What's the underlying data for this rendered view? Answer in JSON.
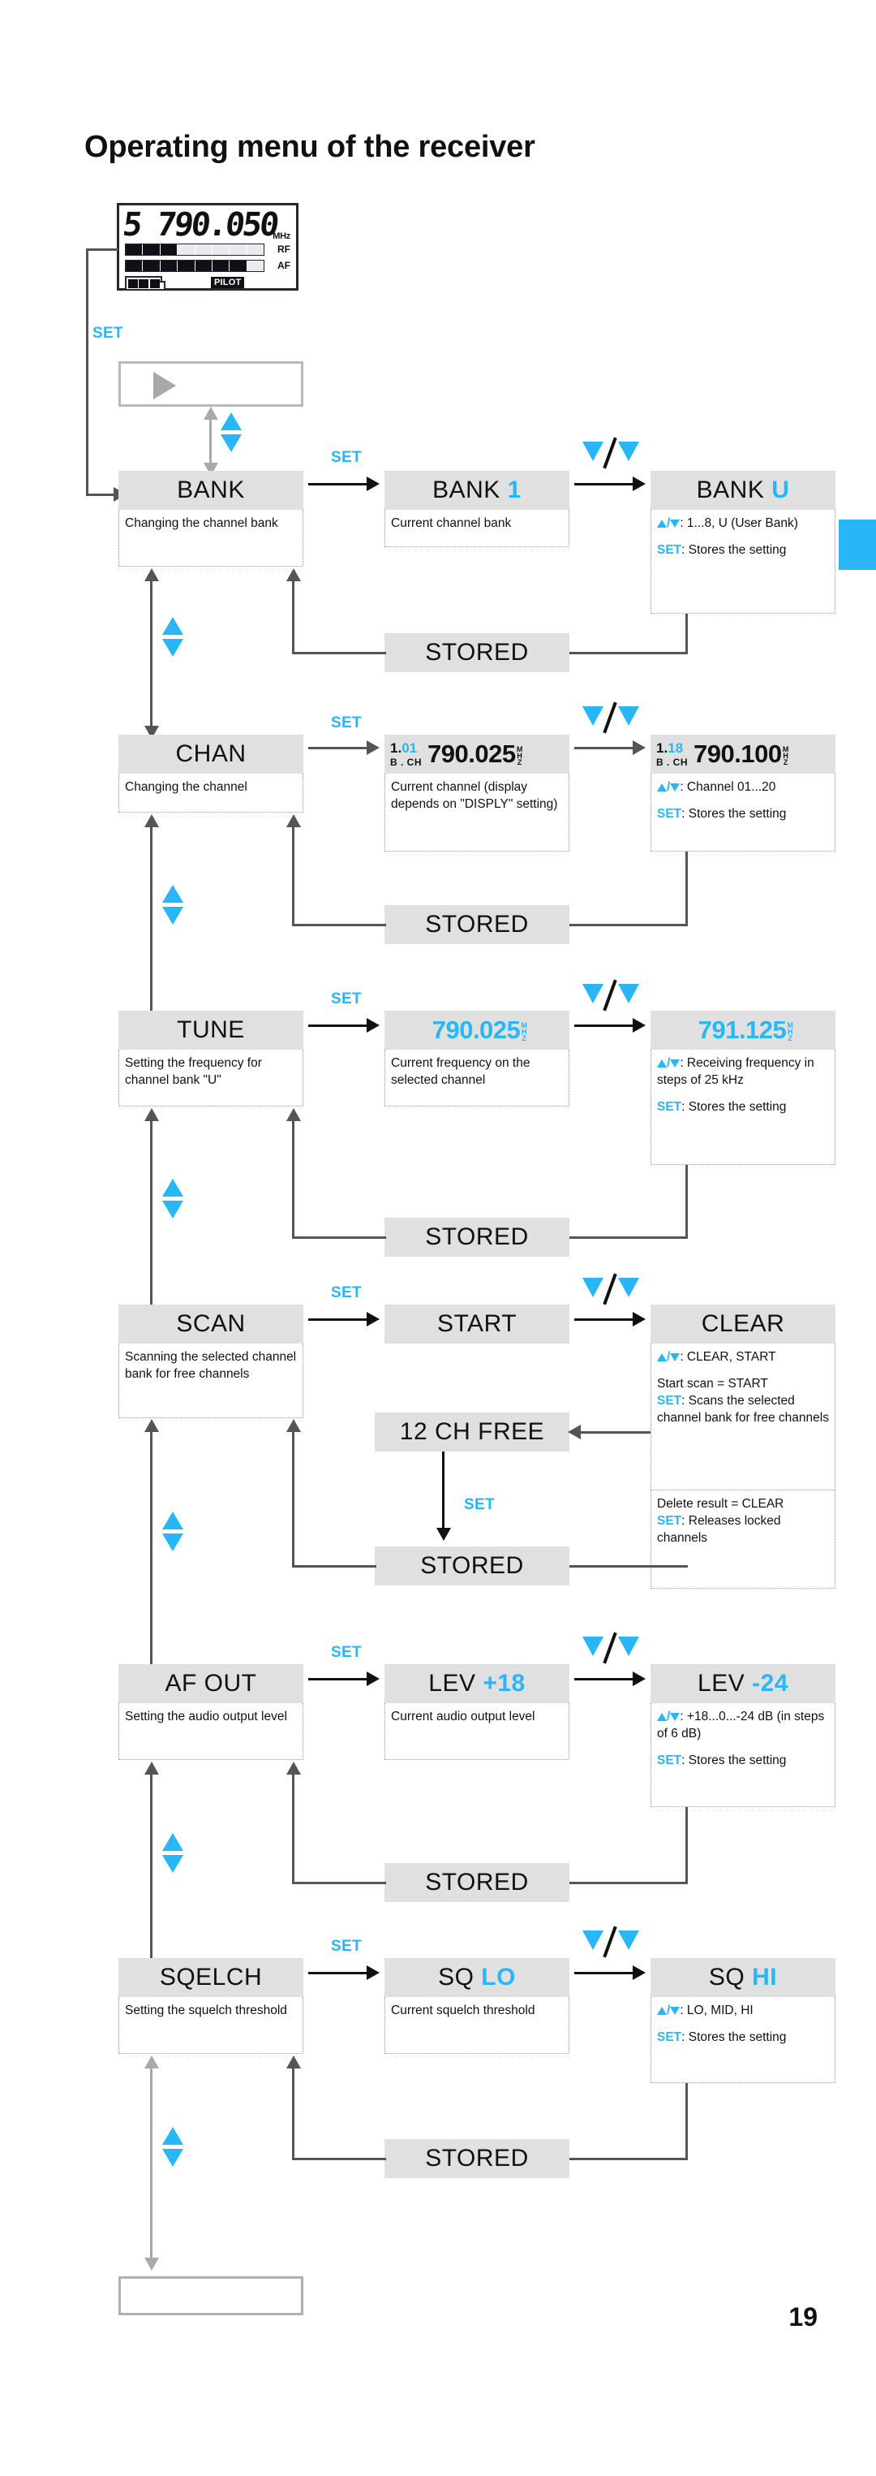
{
  "page": {
    "title": "Operating menu of the receiver",
    "number": "19"
  },
  "lcd": {
    "digits": "5 790.050",
    "unit": "MHz",
    "rf_label": "RF",
    "af_label": "AF",
    "rf_segments_on": 3,
    "rf_segments_total": 8,
    "af_segments_on": 7,
    "af_segments_total": 8,
    "battery_cells": 3,
    "pilot_label": "PILOT"
  },
  "labels": {
    "set": "SET",
    "stored": "STORED"
  },
  "rows": [
    {
      "id": "bank",
      "name": {
        "label": "BANK"
      },
      "name_desc": "Changing the channel bank",
      "current": {
        "label": "BANK",
        "value": "1"
      },
      "current_desc": "Current channel bank",
      "edit": {
        "label": "BANK",
        "value": "U"
      },
      "edit_desc_1": ": 1...8, U (User Bank)",
      "edit_desc_2_key": "SET",
      "edit_desc_2": ": Stores the setting"
    },
    {
      "id": "chan",
      "name": {
        "label": "CHAN"
      },
      "name_desc": "Changing the channel",
      "current": {
        "bank": "1.",
        "ch": "01",
        "sub": "B . CH",
        "freq": "790.025",
        "unit": "MHZ"
      },
      "current_desc": "Current channel (display depends on \"DISPLY\" setting)",
      "edit": {
        "bank": "1.",
        "ch": "18",
        "sub": "B . CH",
        "freq": "790.100",
        "unit": "MHZ"
      },
      "edit_desc_1": ": Channel  01...20",
      "edit_desc_2_key": "SET",
      "edit_desc_2": ": Stores the setting"
    },
    {
      "id": "tune",
      "name": {
        "label": "TUNE"
      },
      "name_desc": "Setting the frequency for channel bank \"U\"",
      "current": {
        "freq": "790.025",
        "unit": "MHZ"
      },
      "current_desc": "Current frequency on the selected channel",
      "edit": {
        "freq": "791.125",
        "unit": "MHZ"
      },
      "edit_desc_1": ": Receiving frequency in steps of 25 kHz",
      "edit_desc_2_key": "SET",
      "edit_desc_2": ": Stores the setting"
    },
    {
      "id": "scan",
      "name": {
        "label": "SCAN"
      },
      "name_desc": "Scanning the selected channel bank for free channels",
      "current": {
        "label": "START"
      },
      "result": {
        "label": "12 CH FREE"
      },
      "result_set": "SET",
      "edit": {
        "label": "CLEAR"
      },
      "edit_desc_1": ": CLEAR, START",
      "edit_desc_block2_line1": "Start scan = START",
      "edit_desc_block2_key": "SET",
      "edit_desc_block2_rest": ": Scans the selected channel bank for free channels",
      "edit_desc_block3_line1": "Delete result = CLEAR",
      "edit_desc_block3_key": "SET",
      "edit_desc_block3_rest": ": Releases locked channels"
    },
    {
      "id": "afout",
      "name": {
        "label": "AF OUT"
      },
      "name_desc": "Setting the audio output level",
      "current": {
        "label": "LEV",
        "value": "+18"
      },
      "current_desc": "Current audio output level",
      "edit": {
        "label": "LEV",
        "value": "-24"
      },
      "edit_desc_1": ": +18...0...-24 dB (in steps of 6 dB)",
      "edit_desc_2_key": "SET",
      "edit_desc_2": ": Stores the setting"
    },
    {
      "id": "sqelch",
      "name": {
        "label": "SQELCH"
      },
      "name_desc": "Setting the squelch threshold",
      "current": {
        "label": "SQ",
        "value": "LO"
      },
      "current_desc": "Current squelch threshold",
      "edit": {
        "label": "SQ",
        "value": "HI"
      },
      "edit_desc_1": ": LO, MID, HI",
      "edit_desc_2_key": "SET",
      "edit_desc_2": ": Stores the setting"
    }
  ],
  "colors": {
    "accent_cyan": "#29b6f6",
    "state_bg": "#e0e0e0",
    "line_gray": "#555555"
  }
}
